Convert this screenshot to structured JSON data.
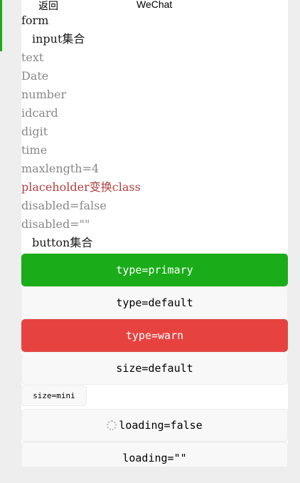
{
  "navbar": {
    "back_label": "返回",
    "title": "WeChat"
  },
  "form": {
    "heading": "form",
    "input_section": "input集合",
    "inputs": [
      {
        "text": "text",
        "tone": "gray"
      },
      {
        "text": "Date",
        "tone": "gray"
      },
      {
        "text": "number",
        "tone": "gray"
      },
      {
        "text": "idcard",
        "tone": "gray"
      },
      {
        "text": "digit",
        "tone": "gray"
      },
      {
        "text": "time",
        "tone": "gray"
      },
      {
        "text": "maxlength=4",
        "tone": "gray"
      },
      {
        "text": "placeholder变换class",
        "tone": "red"
      },
      {
        "text": "disabled=false",
        "tone": "gray"
      },
      {
        "text": "disabled=\"\"",
        "tone": "gray"
      }
    ],
    "button_section": "button集合",
    "buttons": {
      "primary": "type=primary",
      "default": "type=default",
      "warn": "type=warn",
      "size_default": "size=default",
      "size_mini": "size=mini",
      "loading_false": "loading=false",
      "loading_empty": "loading=\"\""
    }
  },
  "colors": {
    "primary": "#1aad19",
    "warn": "#e64340",
    "default_bg": "#f8f8f8",
    "placeholder_red": "#b24040"
  }
}
